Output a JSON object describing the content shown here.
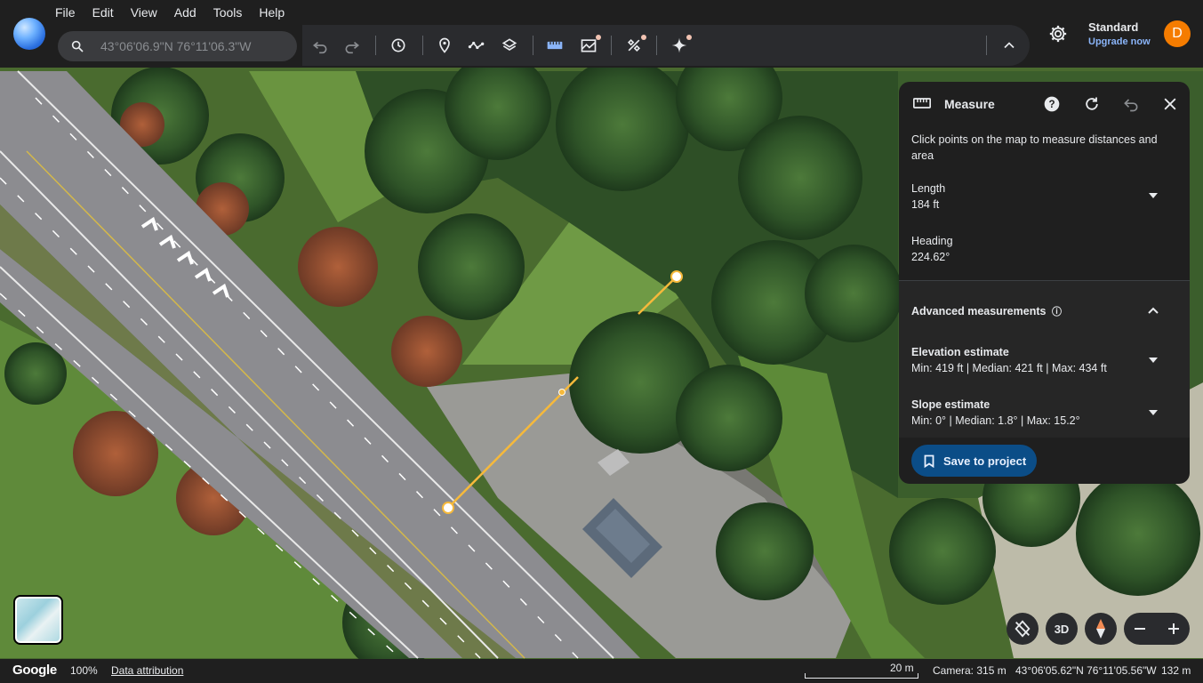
{
  "menu": [
    "File",
    "Edit",
    "View",
    "Add",
    "Tools",
    "Help"
  ],
  "search": {
    "value": "43°06'06.9\"N 76°11'06.3\"W",
    "icon": "search-icon"
  },
  "toolbar": {
    "icons": [
      "undo-icon",
      "redo-icon",
      "history-icon",
      "placemark-icon",
      "path-icon",
      "layers-icon",
      "ruler-icon",
      "elevation-icon",
      "satellite-icon",
      "sparkle-icon",
      "collapse-icon"
    ]
  },
  "account": {
    "plan": "Standard",
    "upgrade": "Upgrade now",
    "avatar": "D",
    "avatar_color": "#f57c00"
  },
  "panel": {
    "title": "Measure",
    "description": "Click points on the map to measure distances and area",
    "length": {
      "label": "Length",
      "value": "184 ft"
    },
    "heading": {
      "label": "Heading",
      "value": "224.62°"
    },
    "advanced": {
      "label": "Advanced measurements",
      "info": "ⓘ"
    },
    "elevation": {
      "label": "Elevation estimate",
      "value": "Min: 419 ft | Median: 421 ft | Max: 434 ft"
    },
    "slope": {
      "label": "Slope estimate",
      "value": "Min: 0° | Median: 1.8° | Max: 15.2°"
    },
    "save": "Save to project",
    "accent": "#0b4d87"
  },
  "measure_line_color": "#f6b93b",
  "controls": {
    "view3d": "3D"
  },
  "status": {
    "brand": "Google",
    "zoom": "100%",
    "attribution": "Data attribution",
    "scale": "20 m",
    "camera": "Camera: 315 m",
    "coords": "43°06'05.62\"N 76°11'05.56\"W",
    "altitude": "132 m"
  }
}
